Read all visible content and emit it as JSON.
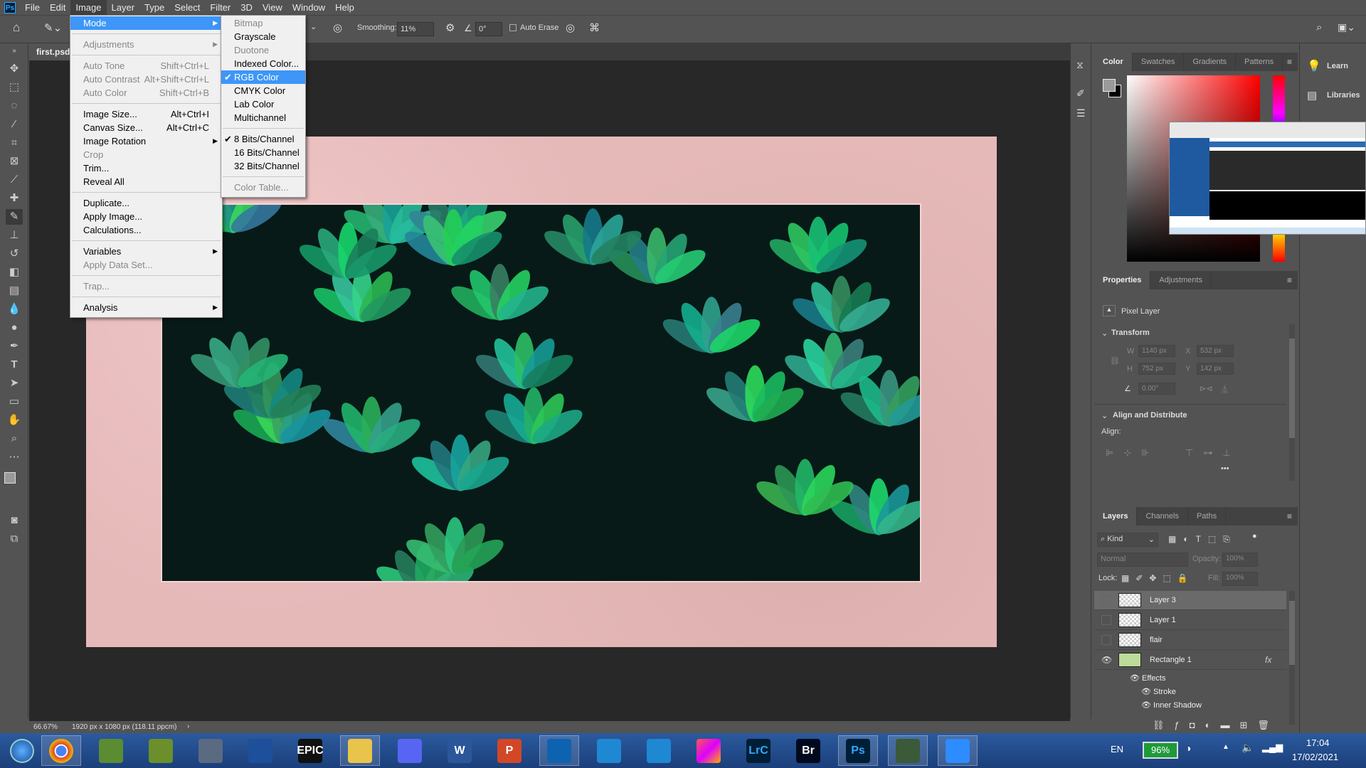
{
  "app": {
    "logo": "Ps",
    "menus": [
      "File",
      "Edit",
      "Image",
      "Layer",
      "Type",
      "Select",
      "Filter",
      "3D",
      "View",
      "Window",
      "Help"
    ],
    "active_menu": "Image"
  },
  "options": {
    "smoothing_label": "Smoothing:",
    "smoothing_value": "11%",
    "angle_value": "0°",
    "auto_erase_label": "Auto Erase",
    "auto_erase_checked": false
  },
  "document": {
    "tab": "first.psd"
  },
  "status": {
    "zoom": "66.67%",
    "info": "1920 px x 1080 px (118.11 ppcm)"
  },
  "image_menu": [
    {
      "label": "Mode",
      "submenu": true,
      "highlighted": true
    },
    {
      "sep": true
    },
    {
      "label": "Adjustments",
      "submenu": true,
      "disabled": true
    },
    {
      "sep": true
    },
    {
      "label": "Auto Tone",
      "shortcut": "Shift+Ctrl+L",
      "disabled": true
    },
    {
      "label": "Auto Contrast",
      "shortcut": "Alt+Shift+Ctrl+L",
      "disabled": true
    },
    {
      "label": "Auto Color",
      "shortcut": "Shift+Ctrl+B",
      "disabled": true
    },
    {
      "sep": true
    },
    {
      "label": "Image Size...",
      "shortcut": "Alt+Ctrl+I"
    },
    {
      "label": "Canvas Size...",
      "shortcut": "Alt+Ctrl+C"
    },
    {
      "label": "Image Rotation",
      "submenu": true
    },
    {
      "label": "Crop",
      "disabled": true
    },
    {
      "label": "Trim..."
    },
    {
      "label": "Reveal All"
    },
    {
      "sep": true
    },
    {
      "label": "Duplicate..."
    },
    {
      "label": "Apply Image..."
    },
    {
      "label": "Calculations..."
    },
    {
      "sep": true
    },
    {
      "label": "Variables",
      "submenu": true
    },
    {
      "label": "Apply Data Set...",
      "disabled": true
    },
    {
      "sep": true
    },
    {
      "label": "Trap...",
      "disabled": true
    },
    {
      "sep": true
    },
    {
      "label": "Analysis",
      "submenu": true
    }
  ],
  "mode_submenu": [
    {
      "label": "Bitmap",
      "disabled": true
    },
    {
      "label": "Grayscale"
    },
    {
      "label": "Duotone",
      "disabled": true
    },
    {
      "label": "Indexed Color..."
    },
    {
      "label": "RGB Color",
      "checked": true,
      "highlighted": true
    },
    {
      "label": "CMYK Color"
    },
    {
      "label": "Lab Color"
    },
    {
      "label": "Multichannel"
    },
    {
      "sep": true
    },
    {
      "label": "8 Bits/Channel",
      "checked": true
    },
    {
      "label": "16 Bits/Channel"
    },
    {
      "label": "32 Bits/Channel"
    },
    {
      "sep": true
    },
    {
      "label": "Color Table...",
      "disabled": true
    }
  ],
  "color_panel": {
    "tabs": [
      "Color",
      "Swatches",
      "Gradients",
      "Patterns"
    ],
    "active": "Color",
    "foreground": "#9a9a9a",
    "background": "#000000",
    "hue": "#ff0000"
  },
  "right_column": {
    "learn": "Learn",
    "libraries": "Libraries"
  },
  "properties": {
    "tabs": [
      "Properties",
      "Adjustments"
    ],
    "layer_type": "Pixel Layer",
    "transform_title": "Transform",
    "w_label": "W",
    "w": "1140 px",
    "h_label": "H",
    "h": "752 px",
    "x_label": "X",
    "x": "532 px",
    "y_label": "Y",
    "y": "142 px",
    "angle": "0.00°",
    "align_title": "Align and Distribute",
    "align_label": "Align:"
  },
  "layers": {
    "tabs": [
      "Layers",
      "Channels",
      "Paths"
    ],
    "kind": "Kind",
    "blend": "Normal",
    "opacity_label": "Opacity:",
    "opacity": "100%",
    "lock_label": "Lock:",
    "fill_label": "Fill:",
    "fill": "100%",
    "items": [
      {
        "name": "Layer 3",
        "visible": false,
        "selected": true
      },
      {
        "name": "Layer 1",
        "visible": false
      },
      {
        "name": "flair",
        "visible": false
      },
      {
        "name": "Rectangle 1",
        "visible": true,
        "fx": "fx"
      }
    ],
    "effects": [
      "Effects",
      "Stroke",
      "Inner Shadow"
    ]
  },
  "taskbar": {
    "apps": [
      "Chrome",
      "Minecraft",
      "Minecraft Dungeons",
      "Steam",
      "Rocket League",
      "Epic Games",
      "File Explorer",
      "Discord",
      "Word",
      "PowerPoint",
      "Visual Studio Code",
      "App",
      "App",
      "Creative Cloud",
      "Lightroom Classic",
      "Bridge",
      "Photoshop",
      "Terminal",
      "Zoom"
    ],
    "labels": {
      "Epic Games": "EPIC",
      "Word": "W",
      "PowerPoint": "P",
      "Lightroom Classic": "LrC",
      "Bridge": "Br",
      "Photoshop": "Ps"
    },
    "lang": "EN",
    "battery": "96%",
    "time": "17:04",
    "date": "17/02/2021"
  }
}
